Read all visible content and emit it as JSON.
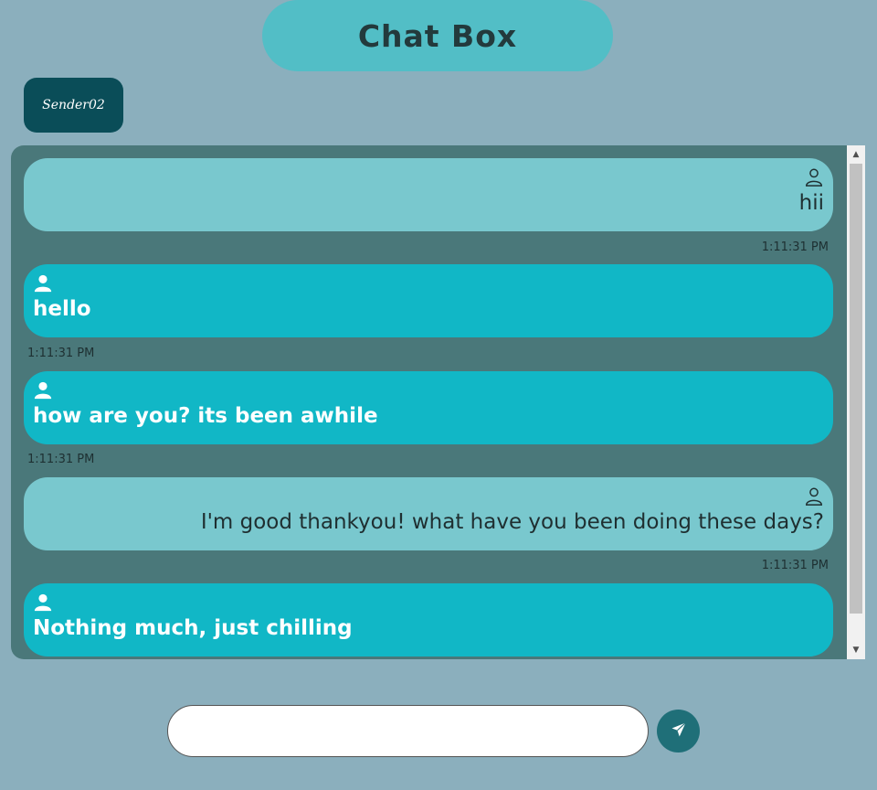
{
  "header": {
    "title": "Chat Box"
  },
  "sender_button": {
    "label": "Sender02"
  },
  "messages": [
    {
      "side": "sent",
      "text": "hii",
      "time": "1:11:31 PM"
    },
    {
      "side": "recv",
      "text": "hello",
      "time": "1:11:31 PM"
    },
    {
      "side": "recv",
      "text": "how are you? its been awhile",
      "time": "1:11:31 PM"
    },
    {
      "side": "sent",
      "text": "I'm good thankyou! what have you been doing these days?",
      "time": "1:11:31 PM"
    },
    {
      "side": "recv",
      "text": "Nothing much, just chilling"
    }
  ],
  "composer": {
    "value": "",
    "placeholder": ""
  },
  "icons": {
    "user": "user-icon",
    "send": "send-icon"
  },
  "colors": {
    "background": "#8bafbd",
    "title_bg": "#52bec6",
    "panel_bg": "#4a787a",
    "sent_bubble": "#79c8ce",
    "received_bubble": "#11b7c6",
    "sender_button_bg": "#0a4d58",
    "send_button_bg": "#1f6f78"
  }
}
